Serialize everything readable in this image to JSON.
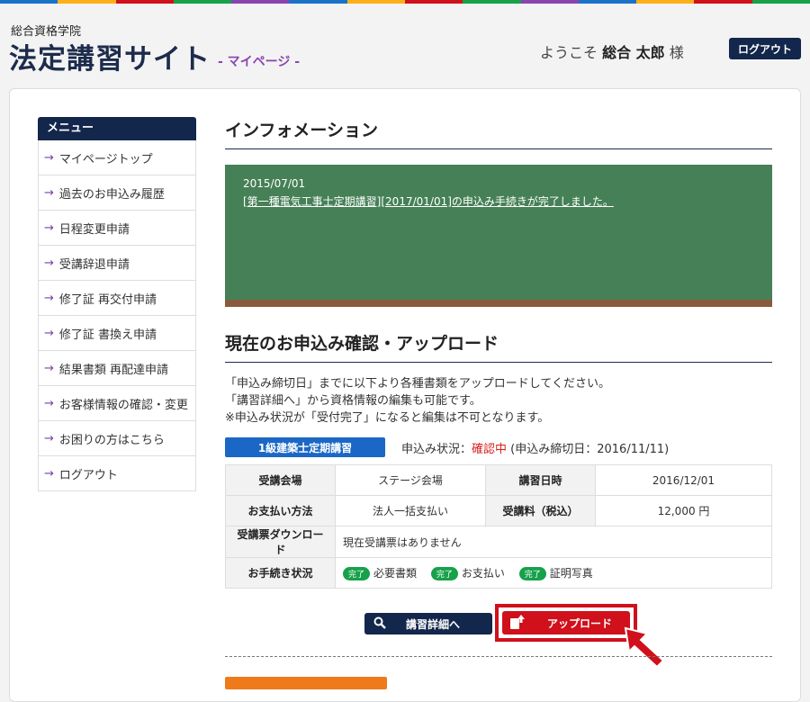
{
  "stripe_colors": [
    "#1a73c7",
    "#fbb01a",
    "#d0101b",
    "#16a14a",
    "#8a44b0",
    "#1a73c7",
    "#fbb01a",
    "#d0101b",
    "#16a14a",
    "#8a44b0",
    "#1a73c7",
    "#fbb01a",
    "#d0101b",
    "#16a14a"
  ],
  "header": {
    "brand_sub": "総合資格学院",
    "brand_title": "法定講習サイト",
    "brand_tag": "- マイページ -",
    "welcome_prefix": "ようこそ",
    "user_name": "総合 太郎",
    "welcome_suffix": "様",
    "logout_label": "ログアウト"
  },
  "menu": {
    "title": "メニュー",
    "items": [
      "マイページトップ",
      "過去のお申込み履歴",
      "日程変更申請",
      "受講辞退申請",
      "修了証 再交付申請",
      "修了証 書換え申請",
      "結果書類 再配達申請",
      "お客様情報の確認・変更",
      "お困りの方はこちら",
      "ログアウト"
    ]
  },
  "info": {
    "title": "インフォメーション",
    "date": "2015/07/01",
    "message": "[第一種電気工事士定期講習][2017/01/01]の申込み手続きが完了しました。"
  },
  "application": {
    "title": "現在のお申込み確認・アップロード",
    "desc": [
      "「申込み締切日」までに以下より各種書類をアップロードしてください。",
      "「講習詳細へ」から資格情報の編集も可能です。",
      "※申込み状況が「受付完了」になると編集は不可となります。"
    ],
    "course_name": "1級建築士定期講習",
    "status_label": "申込み状況：",
    "status_value": "確認中",
    "deadline": "(申込み締切日：2016/11/11)",
    "table": {
      "venue_label": "受講会場",
      "venue_value": "ステージ会場",
      "date_label": "講習日時",
      "date_value": "2016/12/01",
      "payment_label": "お支払い方法",
      "payment_value": "法人一括支払い",
      "fee_label": "受講料（税込）",
      "fee_value": "12,000 円",
      "ticket_label": "受講票ダウンロード",
      "ticket_value": "現在受講票はありません",
      "procedure_label": "お手続き状況",
      "done_badge": "完了",
      "procedures": [
        "必要書類",
        "お支払い",
        "証明写真"
      ]
    },
    "detail_button": "講習詳細へ",
    "upload_button": "アップロード"
  }
}
